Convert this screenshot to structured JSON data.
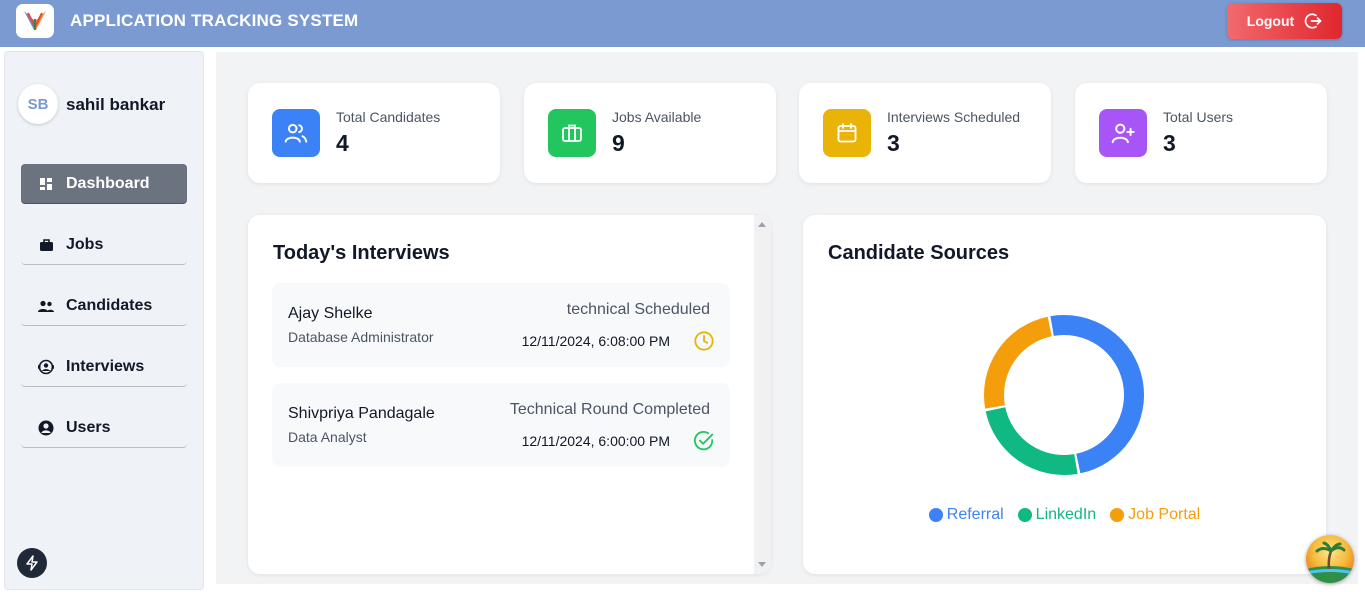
{
  "header": {
    "title": "APPLICATION TRACKING SYSTEM",
    "logout_label": "Logout"
  },
  "sidebar": {
    "user": {
      "initials": "SB",
      "name": "sahil bankar"
    },
    "items": [
      {
        "label": "Dashboard",
        "icon": "dashboard-icon",
        "active": true
      },
      {
        "label": "Jobs",
        "icon": "briefcase-icon"
      },
      {
        "label": "Candidates",
        "icon": "people-icon"
      },
      {
        "label": "Interviews",
        "icon": "interview-icon"
      },
      {
        "label": "Users",
        "icon": "user-circle-icon"
      }
    ]
  },
  "stats": [
    {
      "label": "Total Candidates",
      "value": "4",
      "icon": "users-icon",
      "color": "#3b82f6"
    },
    {
      "label": "Jobs Available",
      "value": "9",
      "icon": "briefcase-icon",
      "color": "#22c55e"
    },
    {
      "label": "Interviews Scheduled",
      "value": "3",
      "icon": "calendar-icon",
      "color": "#eab308"
    },
    {
      "label": "Total Users",
      "value": "3",
      "icon": "user-plus-icon",
      "color": "#a855f7"
    }
  ],
  "interviews": {
    "title": "Today's Interviews",
    "items": [
      {
        "name": "Ajay Shelke",
        "role": "Database Administrator",
        "status": "technical Scheduled",
        "time": "12/11/2024, 6:08:00 PM",
        "icon": "clock-icon"
      },
      {
        "name": "Shivpriya Pandagale",
        "role": "Data Analyst",
        "status": "Technical Round Completed",
        "time": "12/11/2024, 6:00:00 PM",
        "icon": "check-circle-icon"
      }
    ]
  },
  "sources": {
    "title": "Candidate Sources",
    "chart_data": {
      "type": "pie",
      "categories": [
        "Referral",
        "LinkedIn",
        "Job Portal"
      ],
      "values": [
        2,
        1,
        1
      ],
      "colors": [
        "#3b82f6",
        "#10b981",
        "#f59e0b"
      ],
      "legend": "bottom"
    }
  },
  "colors": {
    "header": "#7b9ad1",
    "logout": "#e53935",
    "active_nav": "#6b7280"
  }
}
